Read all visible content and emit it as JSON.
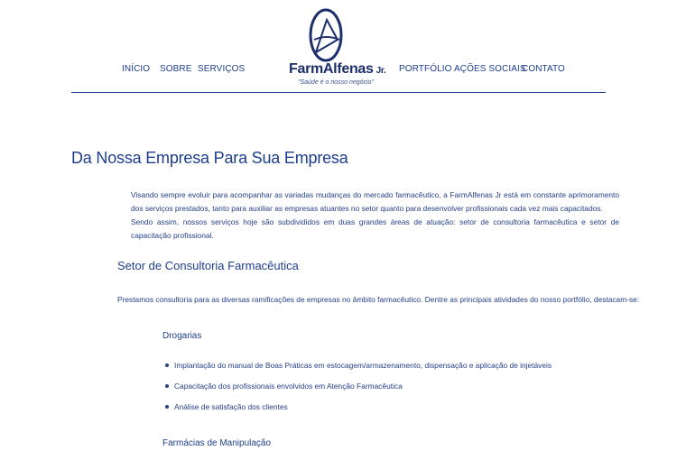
{
  "nav": {
    "left": [
      "INÍCIO",
      "SOBRE",
      "SERVIÇOS"
    ],
    "right": [
      "PORTFÓLIO",
      "AÇÕES SOCIAIS",
      "CONTATO"
    ]
  },
  "logo": {
    "name": "FarmAlfenas",
    "suffix": "Jr.",
    "tagline": "\"Saúde é o nosso negócio\""
  },
  "main": {
    "title": "Da Nossa Empresa Para Sua Empresa",
    "intro": [
      "Visando sempre evoluir para acompanhar as variadas mudanças do mercado farmacêutico, a FarmAlfenas Jr está em constante aprimoramento dos serviços prestados, tanto para auxiliar as empresas atuantes no setor quanto para desenvolver profissionais cada vez mais capacitados.",
      "Sendo assim, nossos serviços hoje são subdivididos em duas grandes áreas de atuação: setor de consultoria farmacêutica e setor de capacitação profissional."
    ],
    "section": {
      "title": "Setor de Consultoria Farmacêutica",
      "text": "Prestamos consultoria para as diversas ramificações de empresas no âmbito farmacêutico. Dentre as principais atividades do nosso portfólio, destacam-se:",
      "subsections": [
        {
          "title": "Drogarias",
          "items": [
            "Implantação do manual de Boas Práticas em estocagem/armazenamento, dispensação e aplicação de injetáveis",
            "Capacitação dos profissionais envolvidos em Atenção Farmacêutica",
            "Análise de satisfação dos clientes"
          ]
        },
        {
          "title": "Farmácias de Manipulação",
          "items": []
        }
      ]
    }
  },
  "colors": {
    "brand": "#1e3e8c",
    "text": "#26408a",
    "divider": "#1f3d8f"
  }
}
